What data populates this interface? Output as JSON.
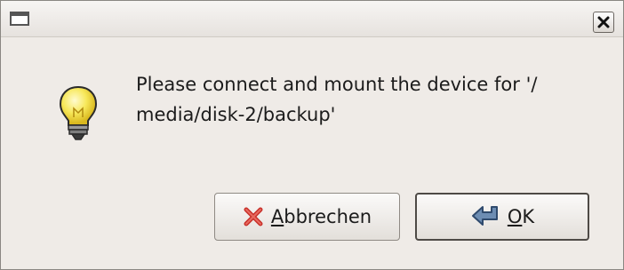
{
  "window": {
    "menu_icon": "window-menu-icon",
    "close_icon": "close-icon"
  },
  "dialog": {
    "icon": "lightbulb-icon",
    "message": "Please connect and mount the device for '/\nmedia/disk-2/backup'"
  },
  "buttons": {
    "cancel": {
      "icon": "cancel-x-icon",
      "mnemonic": "A",
      "rest": "bbrechen"
    },
    "ok": {
      "icon": "return-arrow-icon",
      "mnemonic": "O",
      "rest": "K"
    }
  },
  "colors": {
    "dialog_background": "#efebe7",
    "cancel_icon": "#c8302a",
    "ok_icon": "#6d8db3",
    "bulb": "#f2e04a"
  }
}
